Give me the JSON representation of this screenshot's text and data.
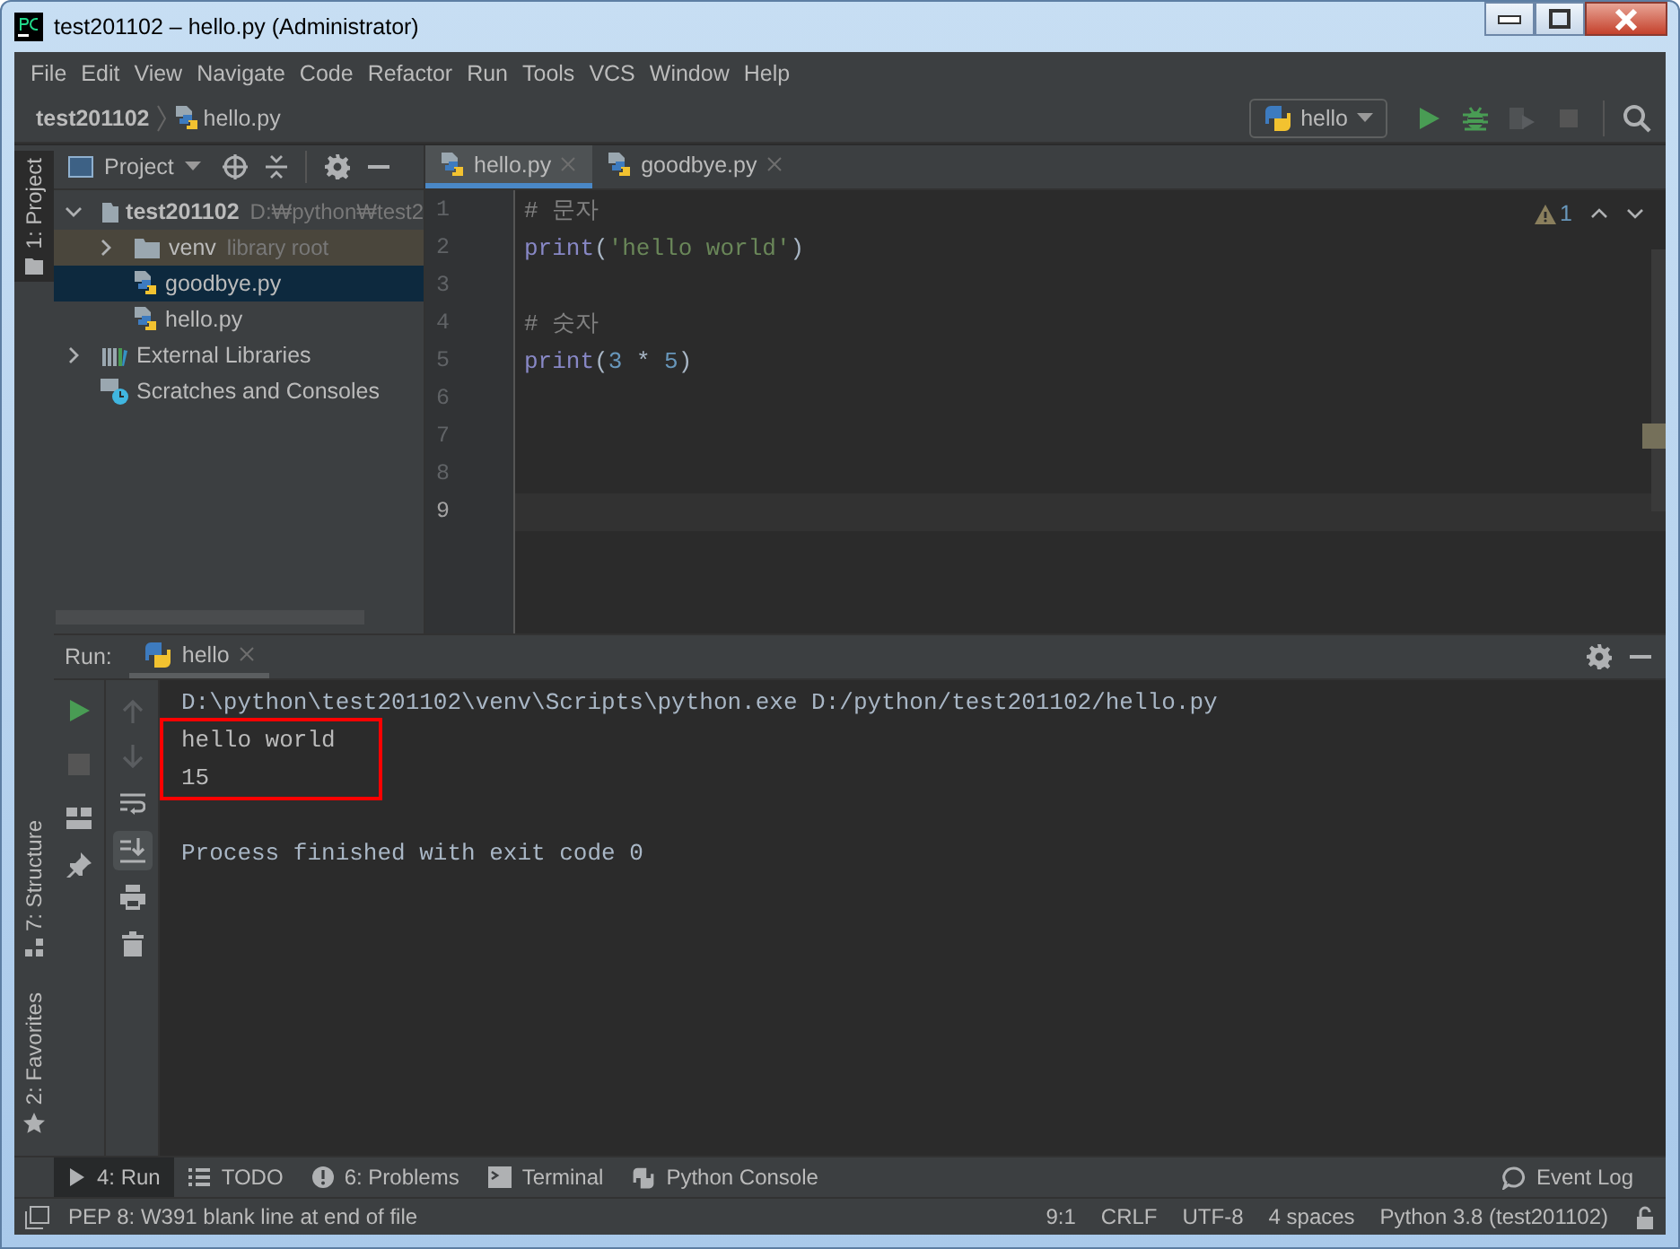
{
  "window": {
    "title": "test201102 – hello.py (Administrator)"
  },
  "menu": [
    "File",
    "Edit",
    "View",
    "Navigate",
    "Code",
    "Refactor",
    "Run",
    "Tools",
    "VCS",
    "Window",
    "Help"
  ],
  "breadcrumb": [
    "test201102",
    "hello.py"
  ],
  "run_config": {
    "label": "hello"
  },
  "toolbar": [
    {
      "kind": "run",
      "disabled": false
    },
    {
      "kind": "debug",
      "disabled": false
    },
    {
      "kind": "coverage",
      "disabled": true
    },
    {
      "kind": "stop",
      "disabled": true
    }
  ],
  "left_stripe": [
    {
      "label": "1: Project",
      "kind": "project",
      "selected": true
    },
    {
      "label": "7: Structure",
      "kind": "structure",
      "selected": false
    },
    {
      "label": "2: Favorites",
      "kind": "favorites",
      "selected": false
    }
  ],
  "project": {
    "title": "Project",
    "tree": [
      {
        "label": "test201102",
        "hint": "D:₩python₩test2",
        "kind": "folder",
        "bold": true,
        "expanded": true,
        "selected": false,
        "hovered": false,
        "children": [
          {
            "label": "venv",
            "hint": "library root",
            "kind": "folder",
            "bold": false,
            "expanded": false,
            "selected": false,
            "hovered": true
          },
          {
            "label": "goodbye.py",
            "kind": "python",
            "bold": false,
            "selected": true,
            "hovered": false
          },
          {
            "label": "hello.py",
            "kind": "python",
            "bold": false,
            "selected": false,
            "hovered": false
          }
        ]
      },
      {
        "label": "External Libraries",
        "kind": "libraries",
        "bold": false,
        "expanded": false,
        "selected": false,
        "hovered": false
      },
      {
        "label": "Scratches and Consoles",
        "kind": "scratches",
        "bold": false,
        "selected": false,
        "hovered": false
      }
    ]
  },
  "tabs": [
    {
      "label": "hello.py",
      "selected": true
    },
    {
      "label": "goodbye.py",
      "selected": false
    }
  ],
  "editor": {
    "warnings": "1",
    "lines": [
      {
        "number": "1",
        "current": false,
        "tokens": [
          {
            "kind": "comment",
            "text": "# 문자"
          }
        ]
      },
      {
        "number": "2",
        "current": false,
        "tokens": [
          {
            "kind": "builtin",
            "text": "print"
          },
          {
            "kind": "plain",
            "text": "("
          },
          {
            "kind": "string",
            "text": "'hello world'"
          },
          {
            "kind": "plain",
            "text": ")"
          }
        ]
      },
      {
        "number": "3",
        "current": false
      },
      {
        "number": "4",
        "current": false,
        "tokens": [
          {
            "kind": "comment",
            "text": "# 숫자"
          }
        ]
      },
      {
        "number": "5",
        "current": false,
        "tokens": [
          {
            "kind": "builtin",
            "text": "print"
          },
          {
            "kind": "plain",
            "text": "("
          },
          {
            "kind": "number",
            "text": "3"
          },
          {
            "kind": "plain",
            "text": " * "
          },
          {
            "kind": "number",
            "text": "5"
          },
          {
            "kind": "plain",
            "text": ")"
          }
        ]
      },
      {
        "number": "6",
        "current": false
      },
      {
        "number": "7",
        "current": false
      },
      {
        "number": "8",
        "current": false
      },
      {
        "number": "9",
        "current": true
      }
    ]
  },
  "run": {
    "label": "Run:",
    "tab": "hello",
    "tools": [
      {
        "kind": "rerun",
        "disabled": false
      },
      {
        "kind": "stop",
        "disabled": true
      },
      {
        "kind": "layout",
        "disabled": false
      },
      {
        "kind": "pin",
        "disabled": false
      }
    ],
    "tools2": [
      {
        "kind": "up",
        "disabled": true,
        "on": false
      },
      {
        "kind": "down",
        "disabled": true,
        "on": false
      },
      {
        "kind": "wrap",
        "disabled": false,
        "on": false
      },
      {
        "kind": "scroll",
        "disabled": false,
        "on": true
      },
      {
        "kind": "print",
        "disabled": false,
        "on": false
      },
      {
        "kind": "trash",
        "disabled": false,
        "on": false
      }
    ],
    "command": "D:\\python\\test201102\\venv\\Scripts\\python.exe D:/python/test201102/hello.py",
    "boxed_output": [
      "hello world",
      "15"
    ],
    "exit_message": "Process finished with exit code 0"
  },
  "tool_windows": [
    {
      "label": "4: Run",
      "kind": "run",
      "selected": true
    },
    {
      "label": "TODO",
      "kind": "todo",
      "selected": false
    },
    {
      "label": "6: Problems",
      "kind": "problems",
      "selected": false
    },
    {
      "label": "Terminal",
      "kind": "terminal",
      "selected": false
    },
    {
      "label": "Python Console",
      "kind": "console",
      "selected": false
    }
  ],
  "event_log": "Event Log",
  "status_bar": {
    "message": "PEP 8: W391 blank line at end of file",
    "items": [
      "9:1",
      "CRLF",
      "UTF-8",
      "4 spaces",
      "Python 3.8 (test201102)"
    ]
  }
}
